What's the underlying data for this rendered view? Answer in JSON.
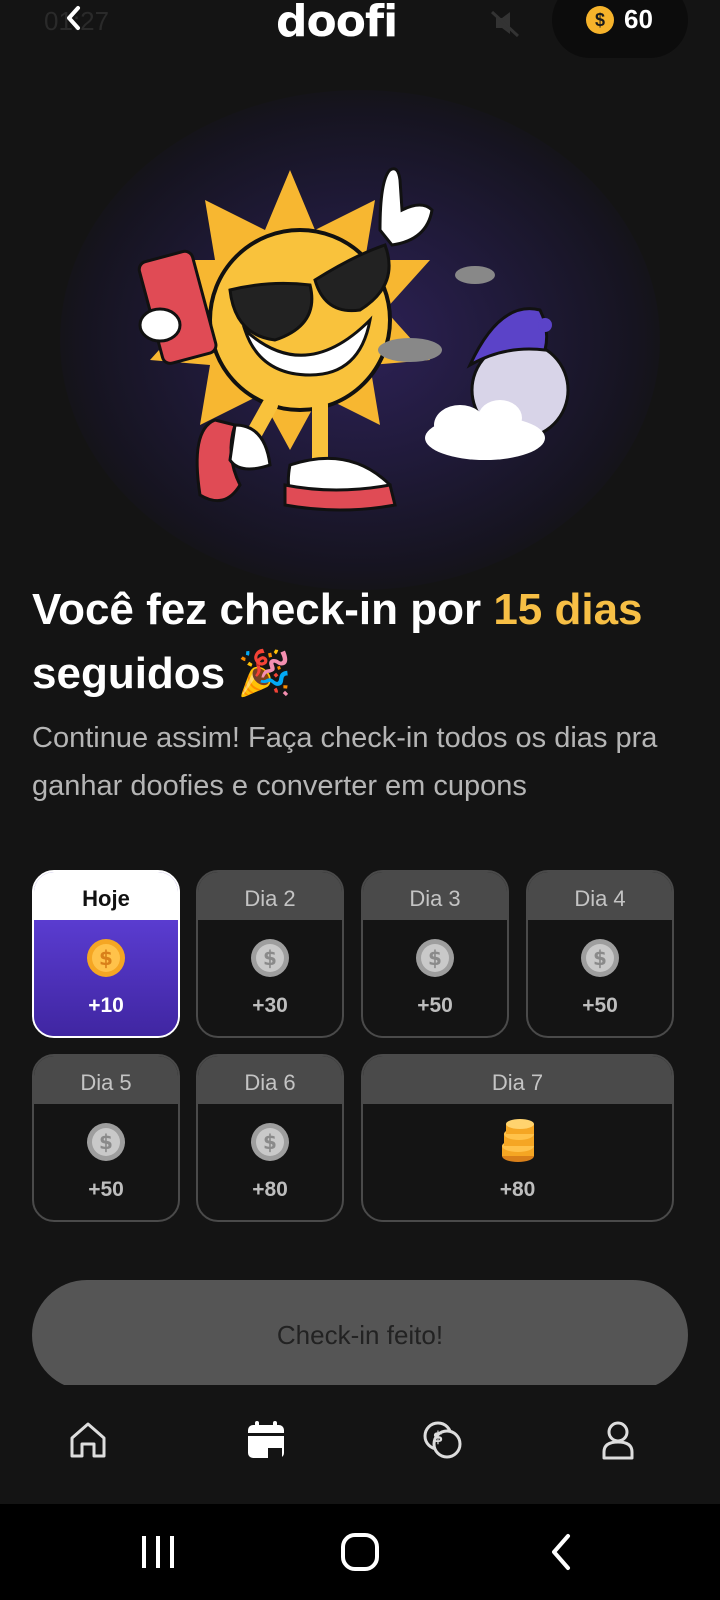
{
  "status": {
    "time": "01:27"
  },
  "header": {
    "logo": "doofi",
    "coins": "60"
  },
  "hero": {
    "title_plain": "Você fez check-in por ",
    "title_highlight": "15 dias",
    "title_end": "seguidos 🎉",
    "subtitle": "Continue assim! Faça check-in todos os dias pra ganhar doofies e converter em cupons"
  },
  "days": [
    {
      "label": "Hoje",
      "reward": "+10"
    },
    {
      "label": "Dia 2",
      "reward": "+30"
    },
    {
      "label": "Dia 3",
      "reward": "+50"
    },
    {
      "label": "Dia 4",
      "reward": "+50"
    },
    {
      "label": "Dia 5",
      "reward": "+50"
    },
    {
      "label": "Dia 6",
      "reward": "+80"
    },
    {
      "label": "Dia 7",
      "reward": "+80"
    }
  ],
  "checkin_button": "Check-in feito!",
  "colors": {
    "accent": "#f7bf45",
    "today_card": "#4a2fb0",
    "background": "#141414"
  },
  "nav": [
    "home-icon",
    "calendar-icon",
    "coins-icon",
    "profile-icon"
  ]
}
